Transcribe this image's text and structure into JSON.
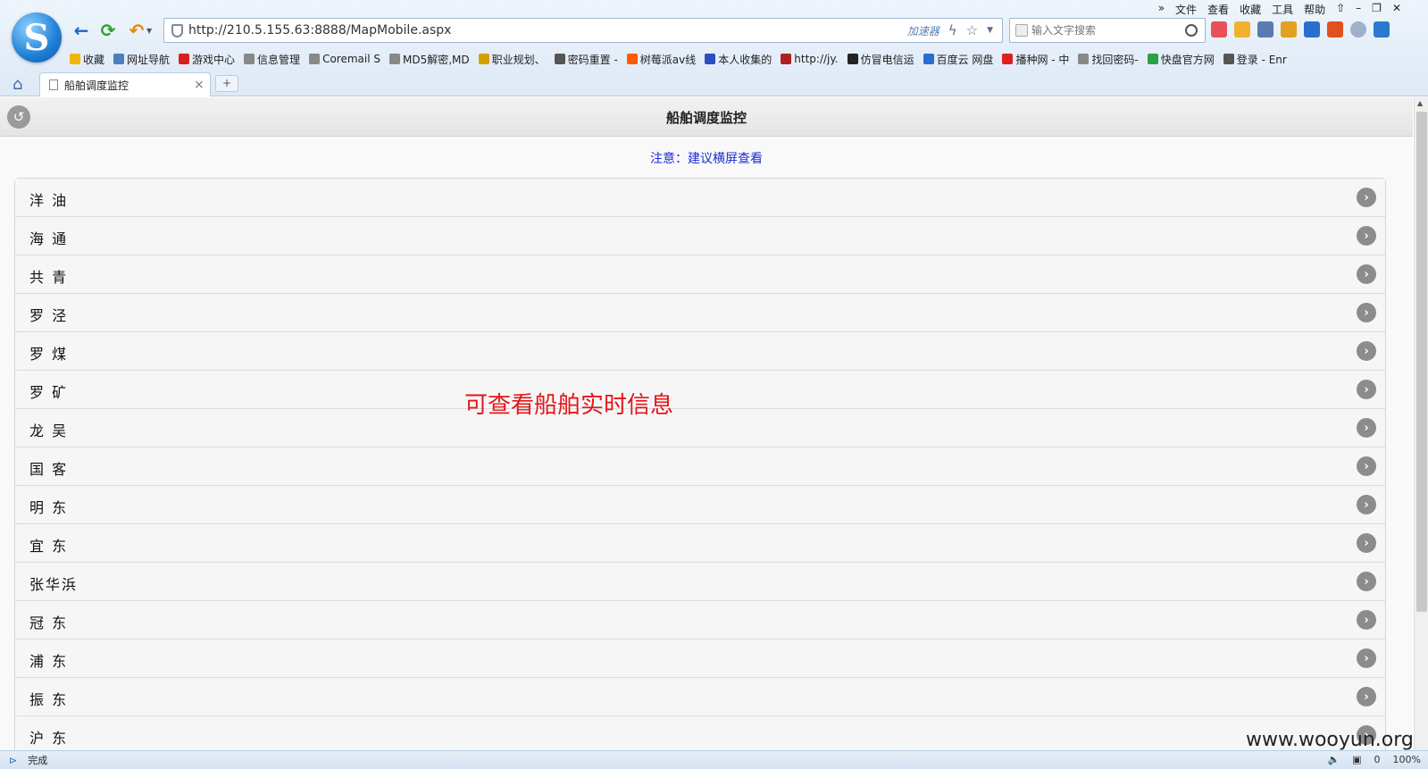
{
  "browser": {
    "url": "http://210.5.155.63:8888/MapMobile.aspx",
    "accelerator_label": "加速器",
    "search_placeholder": "输入文字搜索",
    "menu": [
      "文件",
      "查看",
      "收藏",
      "工具",
      "帮助"
    ],
    "bookmarks": [
      {
        "label": "收藏",
        "icon": "star-icon",
        "color": "#f2b400"
      },
      {
        "label": "网址导航",
        "icon": "globe-icon",
        "color": "#4a7fc0"
      },
      {
        "label": "游戏中心",
        "icon": "game-icon",
        "color": "#d82020"
      },
      {
        "label": "信息管理",
        "icon": "page-icon",
        "color": "#888888"
      },
      {
        "label": "Coremail S",
        "icon": "page-icon",
        "color": "#888888"
      },
      {
        "label": "MD5解密,MD",
        "icon": "page-icon",
        "color": "#888888"
      },
      {
        "label": "职业规划、",
        "icon": "pencil-icon",
        "color": "#d4a000"
      },
      {
        "label": "密码重置 -",
        "icon": "image-icon",
        "color": "#555555"
      },
      {
        "label": "树莓派av线",
        "icon": "taobao-icon",
        "color": "#ff5a00"
      },
      {
        "label": "本人收集的",
        "icon": "paw-icon",
        "color": "#2a4fc0"
      },
      {
        "label": "http://jy.",
        "icon": "site-icon",
        "color": "#b02020"
      },
      {
        "label": "仿冒电信运",
        "icon": "dark-icon",
        "color": "#222222"
      },
      {
        "label": "百度云 网盘",
        "icon": "cloud-icon",
        "color": "#2a6fd0"
      },
      {
        "label": "播种网 - 中",
        "icon": "bo-icon",
        "color": "#e02020"
      },
      {
        "label": "找回密码-",
        "icon": "page-icon",
        "color": "#888888"
      },
      {
        "label": "快盘官方网",
        "icon": "diamond-icon",
        "color": "#2aa04a"
      },
      {
        "label": "登录 - Enr",
        "icon": "image-icon",
        "color": "#555555"
      }
    ],
    "tab_title": "船舶调度监控",
    "status_text": "完成",
    "zoom": "100%",
    "status_count": "0"
  },
  "page": {
    "title": "船舶调度监控",
    "notice": "注意：建议横屏查看",
    "ships": [
      "洋 油",
      "海 通",
      "共 青",
      "罗 泾",
      "罗 煤",
      "罗 矿",
      "龙 吴",
      "国 客",
      "明 东",
      "宜 东",
      "张华浜",
      "冠 东",
      "浦 东",
      "振 东",
      "沪 东"
    ],
    "annotation": "可查看船舶实时信息"
  },
  "watermark": "www.wooyun.org"
}
